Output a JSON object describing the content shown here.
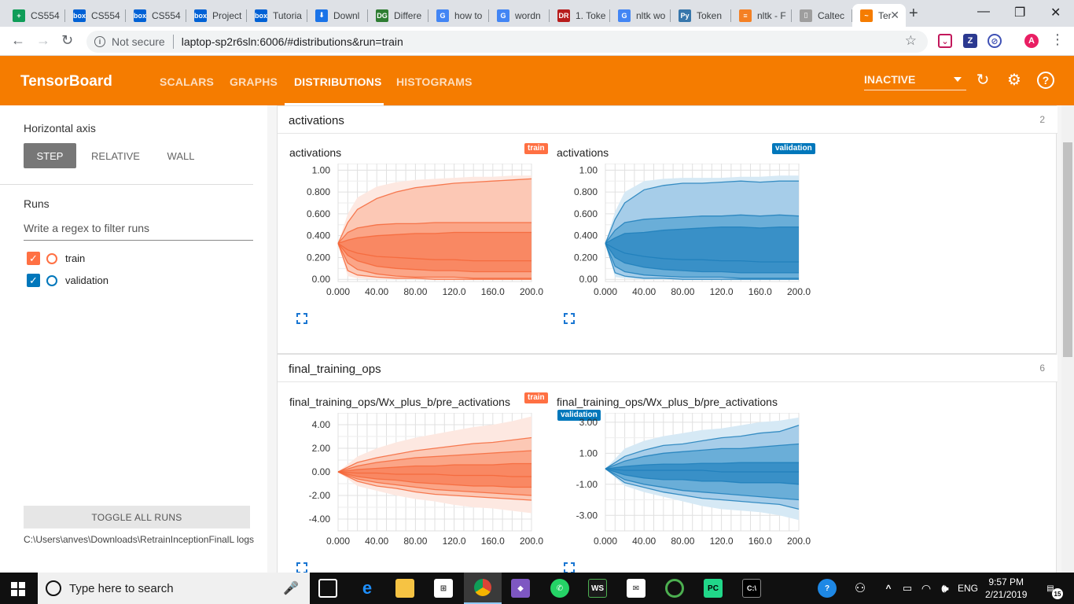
{
  "browser": {
    "tabs": [
      {
        "label": "CS554",
        "fav_text": "+",
        "fav_color": "#0f9d58"
      },
      {
        "label": "CS554",
        "fav_text": "box",
        "fav_color": "#0061d5"
      },
      {
        "label": "CS554",
        "fav_text": "box",
        "fav_color": "#0061d5"
      },
      {
        "label": "Project",
        "fav_text": "box",
        "fav_color": "#0061d5"
      },
      {
        "label": "Tutoria",
        "fav_text": "box",
        "fav_color": "#0061d5"
      },
      {
        "label": "Downl",
        "fav_text": "⬇",
        "fav_color": "#1a73e8"
      },
      {
        "label": "Differe",
        "fav_text": "DG",
        "fav_color": "#2e7d32"
      },
      {
        "label": "how to",
        "fav_text": "G",
        "fav_color": "#4285f4"
      },
      {
        "label": "wordn",
        "fav_text": "G",
        "fav_color": "#4285f4"
      },
      {
        "label": "1. Toke",
        "fav_text": "DR",
        "fav_color": "#b71c1c"
      },
      {
        "label": "nltk wo",
        "fav_text": "G",
        "fav_color": "#4285f4"
      },
      {
        "label": "Token",
        "fav_text": "Py",
        "fav_color": "#3776ab"
      },
      {
        "label": "nltk - F",
        "fav_text": "≡",
        "fav_color": "#f48024"
      },
      {
        "label": "Caltec",
        "fav_text": "▯",
        "fav_color": "#9e9e9e"
      },
      {
        "label": "Ter",
        "fav_text": "~",
        "fav_color": "#f57c00"
      }
    ],
    "not_secure": "Not secure",
    "url": "laptop-sp2r6sln:6006/#distributions&run=train",
    "profile_letter": "A"
  },
  "header": {
    "title": "TensorBoard",
    "tabs": [
      "SCALARS",
      "GRAPHS",
      "DISTRIBUTIONS",
      "HISTOGRAMS"
    ],
    "active_tab": "DISTRIBUTIONS",
    "status": "INACTIVE"
  },
  "sidebar": {
    "horizontal_axis_label": "Horizontal axis",
    "axis_options": [
      "STEP",
      "RELATIVE",
      "WALL"
    ],
    "selected_axis": "STEP",
    "runs_label": "Runs",
    "regex_placeholder": "Write a regex to filter runs",
    "runs": [
      {
        "name": "train",
        "color": "#ff7043"
      },
      {
        "name": "validation",
        "color": "#0077bb"
      }
    ],
    "toggle_all": "TOGGLE ALL RUNS",
    "log_path": "C:\\Users\\anves\\Downloads\\RetrainInceptionFinalL logs"
  },
  "categories": [
    {
      "name": "activations",
      "count": "2",
      "plots": [
        {
          "title": "activations",
          "run": "train"
        },
        {
          "title": "activations",
          "run": "validation"
        }
      ]
    },
    {
      "name": "final_training_ops",
      "count": "6",
      "plots": [
        {
          "title": "final_training_ops/Wx_plus_b/pre_activations",
          "run": "train"
        },
        {
          "title": "final_training_ops/Wx_plus_b/pre_activations",
          "run": "validation"
        }
      ]
    }
  ],
  "chart_data": [
    {
      "type": "area",
      "title": "activations",
      "series_name": "train",
      "x_ticks": [
        "0.000",
        "40.00",
        "80.00",
        "120.0",
        "160.0",
        "200.0"
      ],
      "y_ticks": [
        "0.00",
        "0.200",
        "0.400",
        "0.600",
        "0.800",
        "1.00"
      ],
      "xlim": [
        0,
        200
      ],
      "ylim": [
        -0.02,
        1.06
      ],
      "x": [
        0,
        10,
        20,
        40,
        60,
        80,
        100,
        120,
        140,
        160,
        180,
        200
      ],
      "bands": {
        "max": [
          0.33,
          0.6,
          0.75,
          0.85,
          0.89,
          0.91,
          0.92,
          0.93,
          0.94,
          0.94,
          0.95,
          0.95
        ],
        "p93": [
          0.33,
          0.52,
          0.64,
          0.74,
          0.8,
          0.84,
          0.86,
          0.88,
          0.89,
          0.9,
          0.91,
          0.92
        ],
        "p84": [
          0.33,
          0.43,
          0.47,
          0.5,
          0.51,
          0.51,
          0.52,
          0.52,
          0.52,
          0.52,
          0.52,
          0.52
        ],
        "p69": [
          0.33,
          0.36,
          0.38,
          0.4,
          0.41,
          0.42,
          0.42,
          0.43,
          0.43,
          0.43,
          0.43,
          0.43
        ],
        "p50": [
          0.33,
          0.27,
          0.24,
          0.21,
          0.2,
          0.19,
          0.18,
          0.18,
          0.17,
          0.17,
          0.17,
          0.17
        ],
        "p31": [
          0.33,
          0.22,
          0.17,
          0.12,
          0.1,
          0.09,
          0.08,
          0.08,
          0.07,
          0.07,
          0.07,
          0.07
        ],
        "p16": [
          0.33,
          0.15,
          0.09,
          0.05,
          0.03,
          0.02,
          0.02,
          0.02,
          0.01,
          0.01,
          0.01,
          0.01
        ],
        "p7": [
          0.33,
          0.08,
          0.04,
          0.02,
          0.01,
          0.01,
          0.0,
          0.0,
          0.0,
          0.0,
          0.0,
          0.0
        ],
        "min": [
          0.33,
          0.03,
          0.01,
          0.0,
          0.0,
          0.0,
          0.0,
          0.0,
          0.0,
          0.0,
          0.0,
          0.0
        ]
      }
    },
    {
      "type": "area",
      "title": "activations",
      "series_name": "validation",
      "x_ticks": [
        "0.000",
        "40.00",
        "80.00",
        "120.0",
        "160.0",
        "200.0"
      ],
      "y_ticks": [
        "0.00",
        "0.200",
        "0.400",
        "0.600",
        "0.800",
        "1.00"
      ],
      "xlim": [
        0,
        200
      ],
      "ylim": [
        -0.02,
        1.06
      ],
      "x": [
        0,
        10,
        20,
        40,
        60,
        80,
        100,
        120,
        140,
        160,
        180,
        200
      ],
      "bands": {
        "max": [
          0.33,
          0.62,
          0.8,
          0.9,
          0.92,
          0.93,
          0.93,
          0.93,
          0.94,
          0.94,
          0.95,
          0.95
        ],
        "p93": [
          0.33,
          0.55,
          0.7,
          0.82,
          0.86,
          0.88,
          0.88,
          0.89,
          0.9,
          0.89,
          0.9,
          0.9
        ],
        "p84": [
          0.33,
          0.45,
          0.52,
          0.55,
          0.56,
          0.57,
          0.58,
          0.58,
          0.59,
          0.58,
          0.59,
          0.58
        ],
        "p69": [
          0.33,
          0.38,
          0.42,
          0.43,
          0.45,
          0.46,
          0.47,
          0.48,
          0.48,
          0.47,
          0.48,
          0.48
        ],
        "p50": [
          0.33,
          0.28,
          0.24,
          0.21,
          0.19,
          0.18,
          0.18,
          0.17,
          0.17,
          0.16,
          0.16,
          0.16
        ],
        "p31": [
          0.33,
          0.2,
          0.15,
          0.11,
          0.09,
          0.08,
          0.07,
          0.07,
          0.06,
          0.06,
          0.06,
          0.06
        ],
        "p16": [
          0.33,
          0.12,
          0.07,
          0.04,
          0.03,
          0.02,
          0.02,
          0.02,
          0.01,
          0.01,
          0.01,
          0.01
        ],
        "p7": [
          0.33,
          0.06,
          0.03,
          0.01,
          0.01,
          0.0,
          0.0,
          0.0,
          0.0,
          0.0,
          0.0,
          0.0
        ],
        "min": [
          0.33,
          0.02,
          0.01,
          0.0,
          0.0,
          0.0,
          0.0,
          0.0,
          0.0,
          0.0,
          0.0,
          0.0
        ]
      }
    },
    {
      "type": "area",
      "title": "final_training_ops/Wx_plus_b/pre_activations",
      "series_name": "train",
      "x_ticks": [
        "0.000",
        "40.00",
        "80.00",
        "120.0",
        "160.0",
        "200.0"
      ],
      "y_ticks": [
        "-4.00",
        "-2.00",
        "0.00",
        "2.00",
        "4.00"
      ],
      "xlim": [
        0,
        200
      ],
      "ylim": [
        -5.0,
        5.0
      ],
      "x": [
        0,
        20,
        40,
        60,
        80,
        100,
        120,
        140,
        160,
        180,
        200
      ],
      "bands": {
        "max": [
          0.0,
          1.3,
          2.0,
          2.5,
          2.9,
          3.2,
          3.5,
          3.8,
          4.0,
          4.3,
          4.7
        ],
        "p93": [
          0.0,
          0.8,
          1.2,
          1.5,
          1.8,
          2.0,
          2.2,
          2.4,
          2.5,
          2.7,
          2.9
        ],
        "p84": [
          0.0,
          0.5,
          0.8,
          1.0,
          1.2,
          1.3,
          1.4,
          1.5,
          1.6,
          1.7,
          1.8
        ],
        "p69": [
          0.0,
          0.2,
          0.3,
          0.4,
          0.5,
          0.5,
          0.6,
          0.6,
          0.6,
          0.7,
          0.7
        ],
        "p50": [
          0.0,
          -0.1,
          -0.1,
          -0.2,
          -0.2,
          -0.2,
          -0.3,
          -0.3,
          -0.3,
          -0.4,
          -0.4
        ],
        "p31": [
          0.0,
          -0.4,
          -0.6,
          -0.7,
          -0.9,
          -1.0,
          -1.1,
          -1.2,
          -1.2,
          -1.3,
          -1.3
        ],
        "p16": [
          0.0,
          -0.6,
          -0.9,
          -1.1,
          -1.3,
          -1.5,
          -1.6,
          -1.7,
          -1.8,
          -1.9,
          -2.0
        ],
        "p7": [
          0.0,
          -0.8,
          -1.2,
          -1.4,
          -1.7,
          -1.9,
          -2.0,
          -2.1,
          -2.2,
          -2.3,
          -2.4
        ],
        "min": [
          0.0,
          -1.2,
          -1.6,
          -2.0,
          -2.3,
          -2.5,
          -2.8,
          -3.0,
          -3.1,
          -3.3,
          -3.5
        ]
      }
    },
    {
      "type": "area",
      "title": "final_training_ops/Wx_plus_b/pre_activations",
      "series_name": "validation",
      "x_ticks": [
        "0.000",
        "40.00",
        "80.00",
        "120.0",
        "160.0",
        "200.0"
      ],
      "y_ticks": [
        "-3.00",
        "-1.00",
        "1.00",
        "3.00"
      ],
      "xlim": [
        0,
        200
      ],
      "ylim": [
        -4.0,
        3.6
      ],
      "x": [
        0,
        20,
        40,
        60,
        80,
        100,
        120,
        140,
        160,
        180,
        200
      ],
      "bands": {
        "max": [
          0.0,
          1.3,
          1.8,
          2.1,
          2.3,
          2.5,
          2.6,
          2.8,
          3.0,
          3.1,
          3.3
        ],
        "p93": [
          0.0,
          0.8,
          1.2,
          1.5,
          1.6,
          1.8,
          2.0,
          2.1,
          2.3,
          2.4,
          2.8
        ],
        "p84": [
          0.0,
          0.5,
          0.8,
          1.0,
          1.1,
          1.2,
          1.3,
          1.3,
          1.4,
          1.5,
          1.6
        ],
        "p69": [
          0.0,
          0.15,
          0.25,
          0.3,
          0.3,
          0.35,
          0.35,
          0.4,
          0.4,
          0.4,
          0.4
        ],
        "p50": [
          0.0,
          -0.1,
          -0.1,
          -0.1,
          -0.1,
          -0.1,
          -0.2,
          -0.2,
          -0.2,
          -0.2,
          -0.2
        ],
        "p31": [
          0.0,
          -0.4,
          -0.6,
          -0.7,
          -0.7,
          -0.8,
          -0.8,
          -0.9,
          -0.9,
          -0.9,
          -1.0
        ],
        "p16": [
          0.0,
          -0.7,
          -1.0,
          -1.2,
          -1.4,
          -1.5,
          -1.6,
          -1.7,
          -1.8,
          -1.9,
          -2.0
        ],
        "p7": [
          0.0,
          -0.9,
          -1.2,
          -1.5,
          -1.7,
          -1.9,
          -2.0,
          -2.1,
          -2.2,
          -2.3,
          -2.6
        ],
        "min": [
          0.0,
          -1.1,
          -1.5,
          -1.8,
          -2.1,
          -2.4,
          -2.6,
          -2.7,
          -2.8,
          -3.0,
          -3.3
        ]
      }
    }
  ],
  "taskbar": {
    "search_placeholder": "Type here to search",
    "lang": "ENG",
    "time": "9:57 PM",
    "date": "2/21/2019",
    "notif_count": "15"
  },
  "colors": {
    "header_orange": "#f57c00",
    "train": "#ff7043",
    "validation": "#0077bb"
  }
}
